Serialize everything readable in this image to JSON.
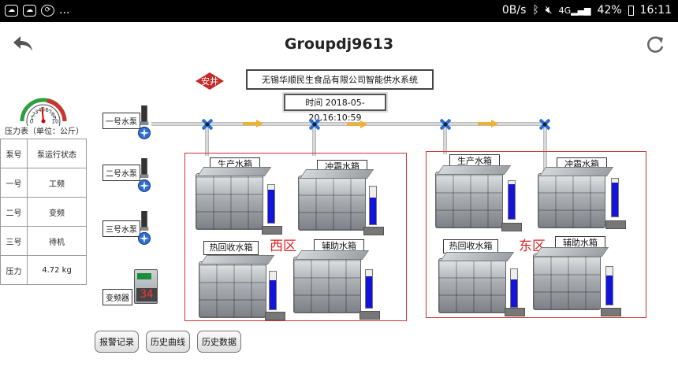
{
  "statusbar": {
    "left_icons": [
      "cloud-icon",
      "cloud-icon",
      "sync-icon",
      "more-icon"
    ],
    "more": "...",
    "net_speed": "0B/s",
    "battery": "42%",
    "time": "16:11"
  },
  "appbar": {
    "title": "Groupdj9613"
  },
  "header": {
    "logo_text": "安井",
    "system_title": "无锡华顺民生食品有限公司智能供水系统",
    "time_text": "时间 2018-05-20,16:10:59"
  },
  "gauge": {
    "label": "压力表（单位：公斤）",
    "ticks": [
      "0",
      "1",
      "2",
      "3",
      "4",
      "5",
      "6",
      "7",
      "8",
      "9",
      "10"
    ],
    "value": 4.72
  },
  "pump_table": {
    "headers": [
      "泵号",
      "泵运行状态"
    ],
    "rows": [
      [
        "一号",
        "工频"
      ],
      [
        "二号",
        "变频"
      ],
      [
        "三号",
        "待机"
      ],
      [
        "压力",
        "4.72  kg"
      ]
    ]
  },
  "pumps": [
    {
      "label": "一号水泵"
    },
    {
      "label": "二号水泵"
    },
    {
      "label": "三号水泵"
    }
  ],
  "vfd": {
    "label": "变频器",
    "readout": "34"
  },
  "zones": {
    "west": {
      "label": "西区",
      "tanks": [
        {
          "label": "生产水箱",
          "level": 0.88
        },
        {
          "label": "冲霜水箱",
          "level": 0.7
        },
        {
          "label": "热回收水箱",
          "level": 0.78
        },
        {
          "label": "辅助水箱",
          "level": 0.84
        }
      ]
    },
    "east": {
      "label": "东区",
      "tanks": [
        {
          "label": "生产水箱",
          "level": 0.92
        },
        {
          "label": "冲霜水箱",
          "level": 0.9
        },
        {
          "label": "热回收水箱",
          "level": 0.72
        },
        {
          "label": "辅助水箱",
          "level": 0.78
        }
      ]
    }
  },
  "buttons": {
    "alarm": "报警记录",
    "history_curve": "历史曲线",
    "history_data": "历史数据"
  },
  "colors": {
    "level_fill": "#1414d8",
    "zone_border": "#cc3333",
    "zone_text": "#dd2222",
    "valve": "#2a6fd6",
    "flow_arrow": "#f0b030"
  }
}
